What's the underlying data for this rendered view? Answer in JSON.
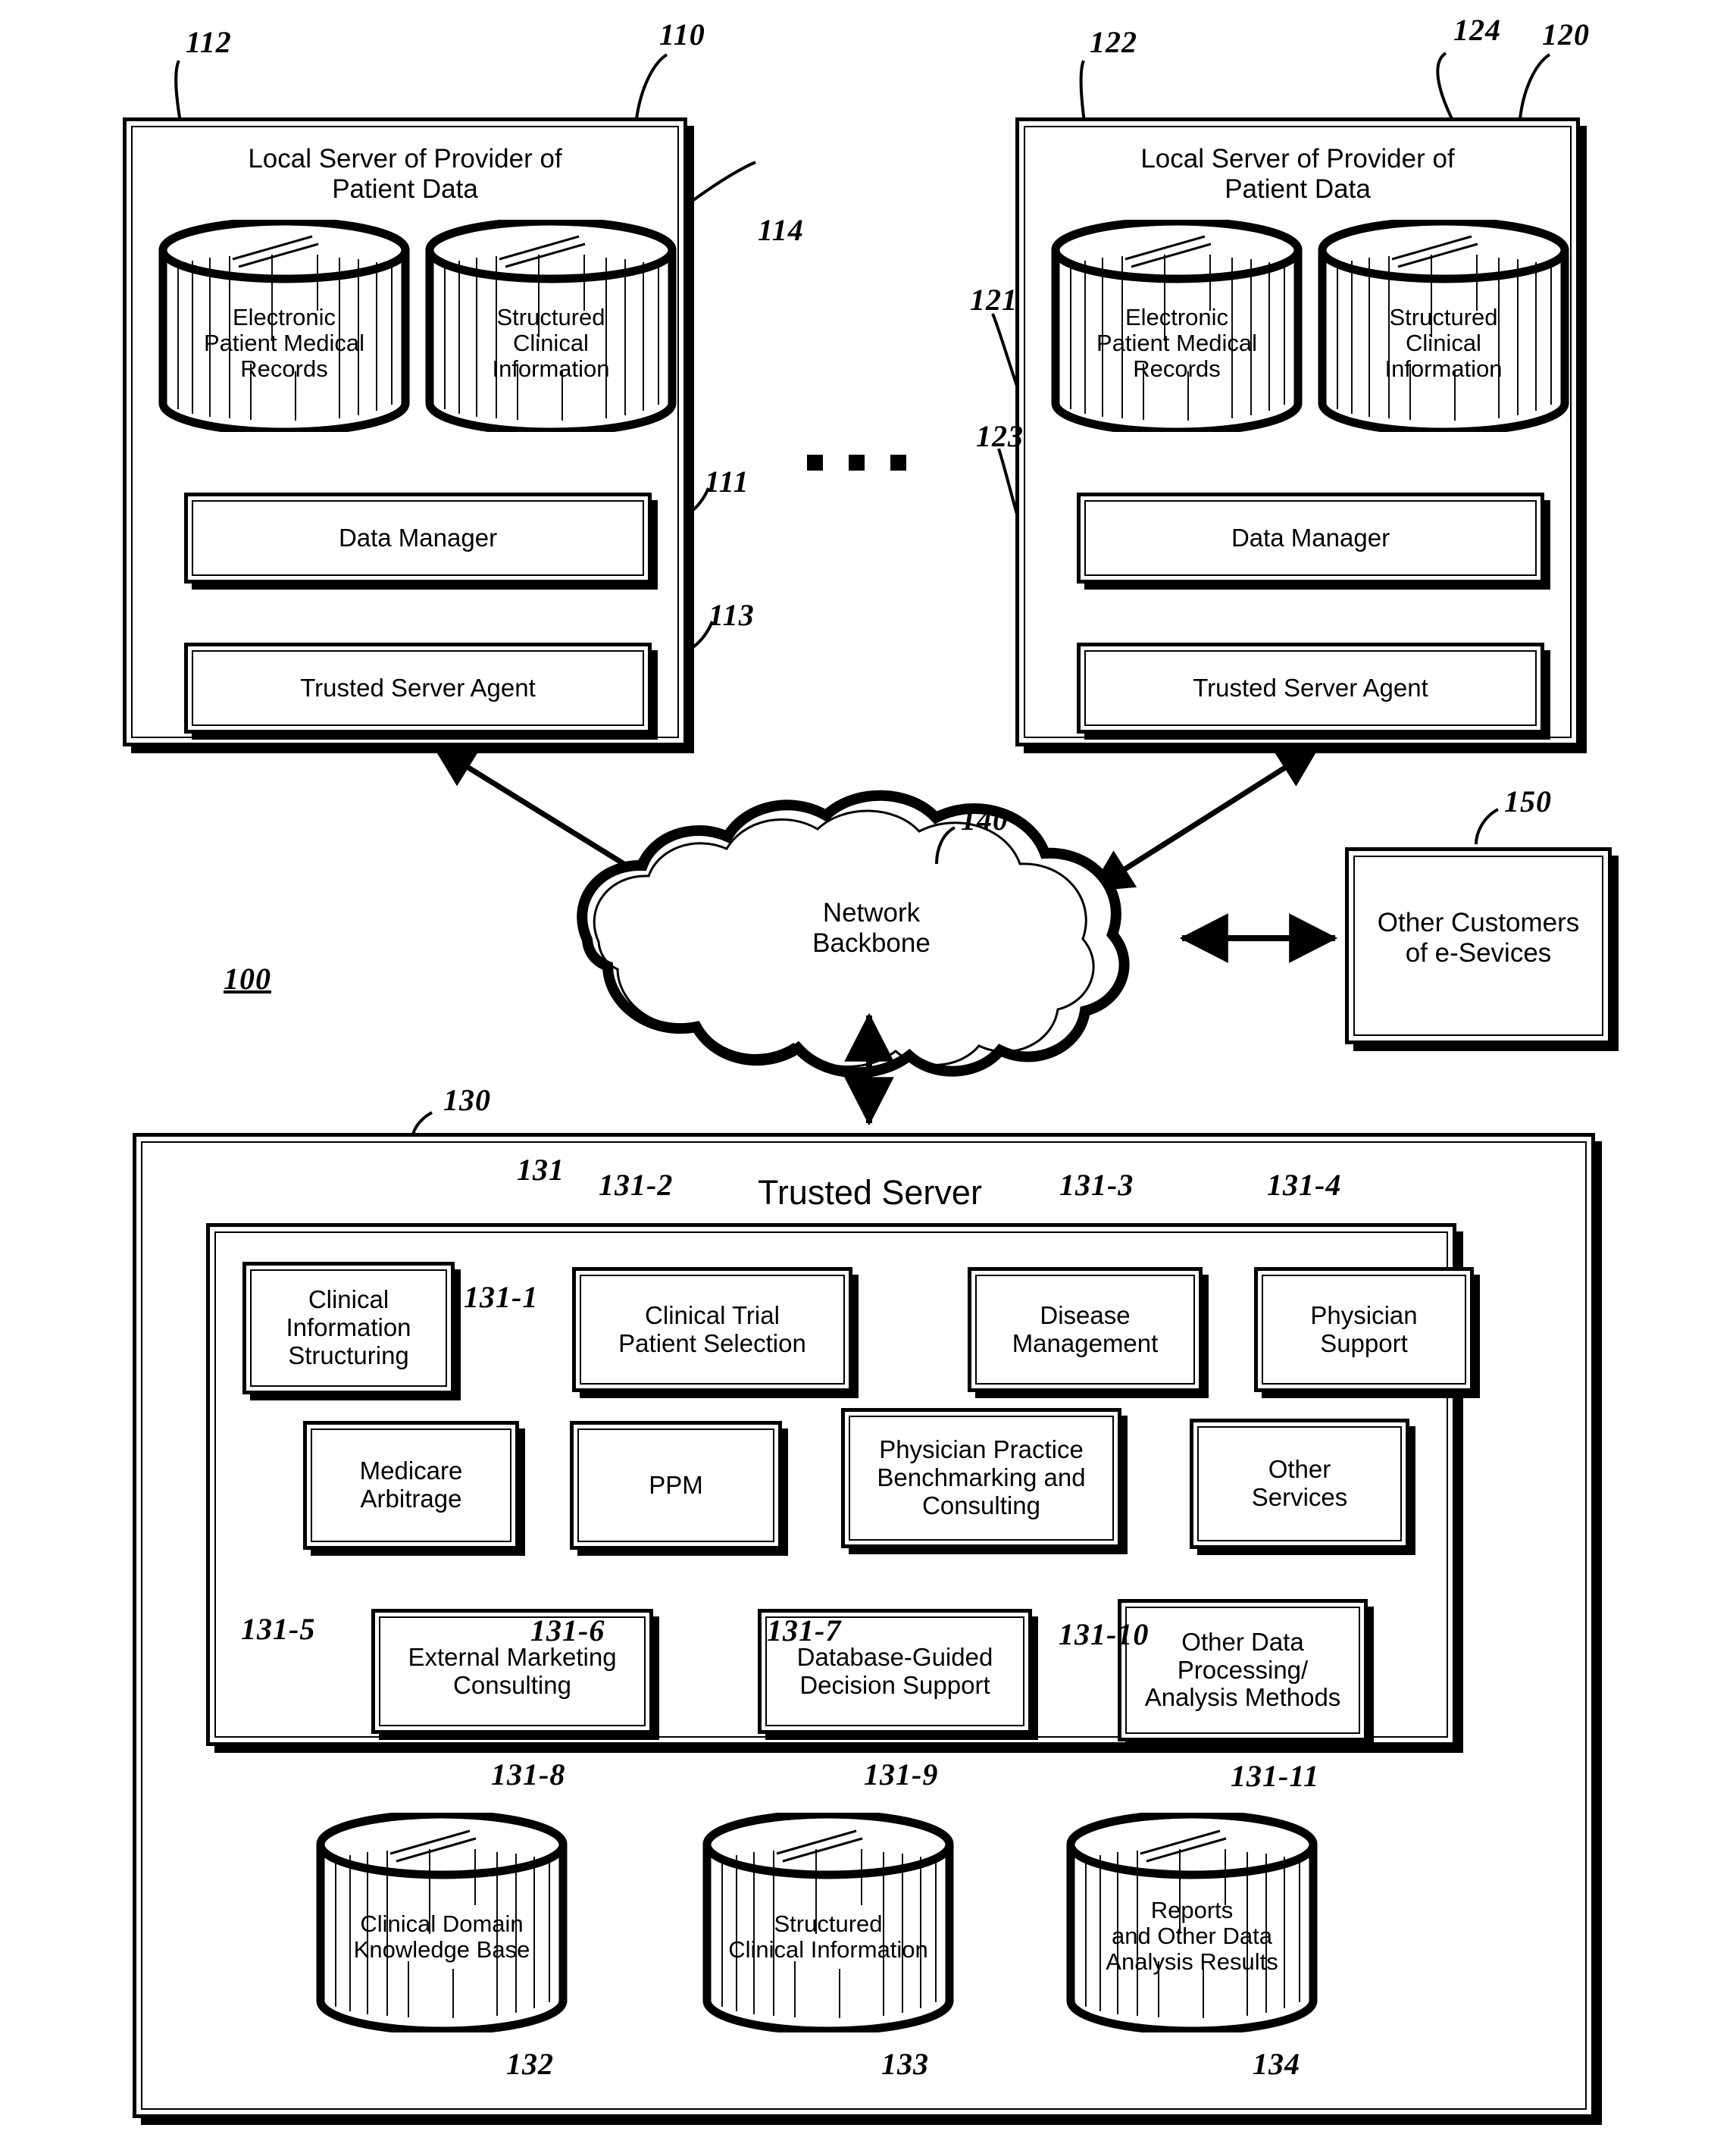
{
  "figure": {
    "system_ref": "100",
    "local_server_left": {
      "ref": "110",
      "title": "Local Server of Provider of\nPatient Data",
      "db_emr": {
        "ref": "112",
        "label": "Electronic\nPatient Medical\nRecords"
      },
      "db_sci": {
        "ref": "114",
        "label": "Structured\nClinical\nInformation"
      },
      "data_manager": {
        "ref": "111",
        "label": "Data Manager"
      },
      "trusted_server_agent": {
        "ref": "113",
        "label": "Trusted Server Agent"
      }
    },
    "local_server_right": {
      "ref": "120",
      "title": "Local Server of Provider of\nPatient Data",
      "db_emr": {
        "ref": "122",
        "label": "Electronic\nPatient Medical\nRecords"
      },
      "db_sci": {
        "ref": "124",
        "label": "Structured\nClinical\nInformation"
      },
      "data_manager": {
        "ref": "121",
        "label": "Data Manager"
      },
      "trusted_server_agent": {
        "ref": "123",
        "label": "Trusted Server Agent"
      }
    },
    "network": {
      "ref": "140",
      "label": "Network\nBackbone"
    },
    "other_customers": {
      "ref": "150",
      "label": "Other Customers\nof e-Sevices"
    },
    "trusted_server": {
      "ref": "130",
      "title": "Trusted Server",
      "services_container_ref": "131",
      "services": [
        {
          "ref": "131-1",
          "label": "Clinical\nInformation\nStructuring"
        },
        {
          "ref": "131-2",
          "label": "Clinical Trial\nPatient Selection"
        },
        {
          "ref": "131-3",
          "label": "Disease\nManagement"
        },
        {
          "ref": "131-4",
          "label": "Physician\nSupport"
        },
        {
          "ref": "131-5",
          "label": "Medicare\nArbitrage"
        },
        {
          "ref": "131-6",
          "label": "PPM"
        },
        {
          "ref": "131-7",
          "label": "Physician Practice\nBenchmarking and\nConsulting"
        },
        {
          "ref": "131-10",
          "label": "Other\nServices"
        },
        {
          "ref": "131-8",
          "label": "External Marketing\nConsulting"
        },
        {
          "ref": "131-9",
          "label": "Database-Guided\nDecision Support"
        },
        {
          "ref": "131-11",
          "label": "Other Data\nProcessing/\nAnalysis Methods"
        }
      ],
      "databases": [
        {
          "ref": "132",
          "label": "Clinical Domain\nKnowledge Base"
        },
        {
          "ref": "133",
          "label": "Structured\nClinical Information"
        },
        {
          "ref": "134",
          "label": "Reports\nand Other Data\nAnalysis Results"
        }
      ]
    },
    "ellipsis": "▪ ▪ ▪"
  }
}
